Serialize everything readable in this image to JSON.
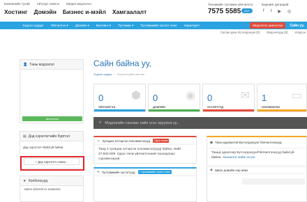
{
  "header": {
    "sublinks": [
      "Компанийн тухай",
      "Айтузус хэвлэх",
      "Медио медээлэл"
    ],
    "mainlinks": [
      "Хостинг",
      "Домэйн",
      "Бизнес и-мэйл",
      "Хамгаалалт"
    ],
    "support_label": "Техникийн тусламж үйлчилгээ",
    "phone": "7575 5585",
    "phone_badge": "24/7",
    "social_title": "Биднийг дагаарай",
    "social_icons": [
      "facebook-icon",
      "twitter-icon",
      "youtube-icon",
      "instagram-icon"
    ]
  },
  "nav": {
    "items": [
      "Үндсэн хуудас",
      "Үйлчилгээ ▾",
      "Домэйн ▾",
      "Биллинг ▾",
      "Тусламж ▾",
      "Тусламжийн хүсэлт нээх",
      "Харилцагч"
    ],
    "admin_button": "Медээлэл шинэчлэх",
    "account": "Сайн уу,"
  },
  "subrow": {
    "items": [
      "Сагсан дахь бүтээгдэхүүн (0)",
      "Мэдээллүүд (0)",
      "Нэгдсэн"
    ]
  },
  "sidebar": {
    "info_panel_title": "Таны мэдээлэл",
    "update_button": "Шинэчлэх",
    "contacts_title": "Дэд хэрэглэгчийн бүртгэл",
    "contacts_empty": "Дэд хэрэглэгч байхгүй байна",
    "add_contact_button": "+ Дэд хэрэглэгч нэмэх...",
    "shortcuts_title": "Холбоосууд",
    "shortcuts": [
      "Шинэ үйлчилгээ захиалах"
    ]
  },
  "main": {
    "welcome": "Сайн байна уу,",
    "breadcrumb_home": "Үндсэн хуудас",
    "breadcrumb_current": "Хэрэглэгчийн систем",
    "stats": [
      {
        "value": "0",
        "label": "ҮЙЛЧИЛГЭЭ",
        "color": "#2aa3e0",
        "icon": "cube-icon",
        "glyph": "⬢"
      },
      {
        "value": "0",
        "label": "ДОМЭЙН",
        "color": "#4caf50",
        "icon": "globe-icon",
        "glyph": "◉"
      },
      {
        "value": "0",
        "label": "ХҮСЭЛТҮҮД",
        "color": "#e74c3c",
        "icon": "comments-icon",
        "glyph": "✉"
      },
      {
        "value": "1",
        "label": "НЭХЭМЖЛЭХ",
        "color": "#f5a623",
        "icon": "card-icon",
        "glyph": "▭"
      }
    ],
    "search_placeholder": "Мэдлэгийн сангаас хайх үгээ оруулна уу...",
    "invoice_card": {
      "title": "Хугацаа Хэтэрсэн Нэхэмжлэхүүд",
      "pill": "Одоо төлөх",
      "body": "Танд 1 хугацаа хэтэрсэн нэхэмжлэх(үүд) байна. Нийт 27,500.00₮. Одоо төлж үйлчилгээний тасалдлаас сэргийлээрэй."
    },
    "tickets_card": {
      "title": "Тусламжийн хүсэлтүүд",
      "pill": "+ Тусламжийн хүсэлт нээх"
    },
    "domains_card": {
      "title": "Таны идэвхитэй Бүтээгдэхүүн/ Үйлчилгээнүүд",
      "body": "Таньд одоогоор Бүтээгдэхүүн/Үйлчилгээнүүд байхгүй байна.",
      "link": "Захиалга хийж эхлэх."
    },
    "news_card": {
      "title": "Шинэ домэйн нэр авах"
    }
  }
}
